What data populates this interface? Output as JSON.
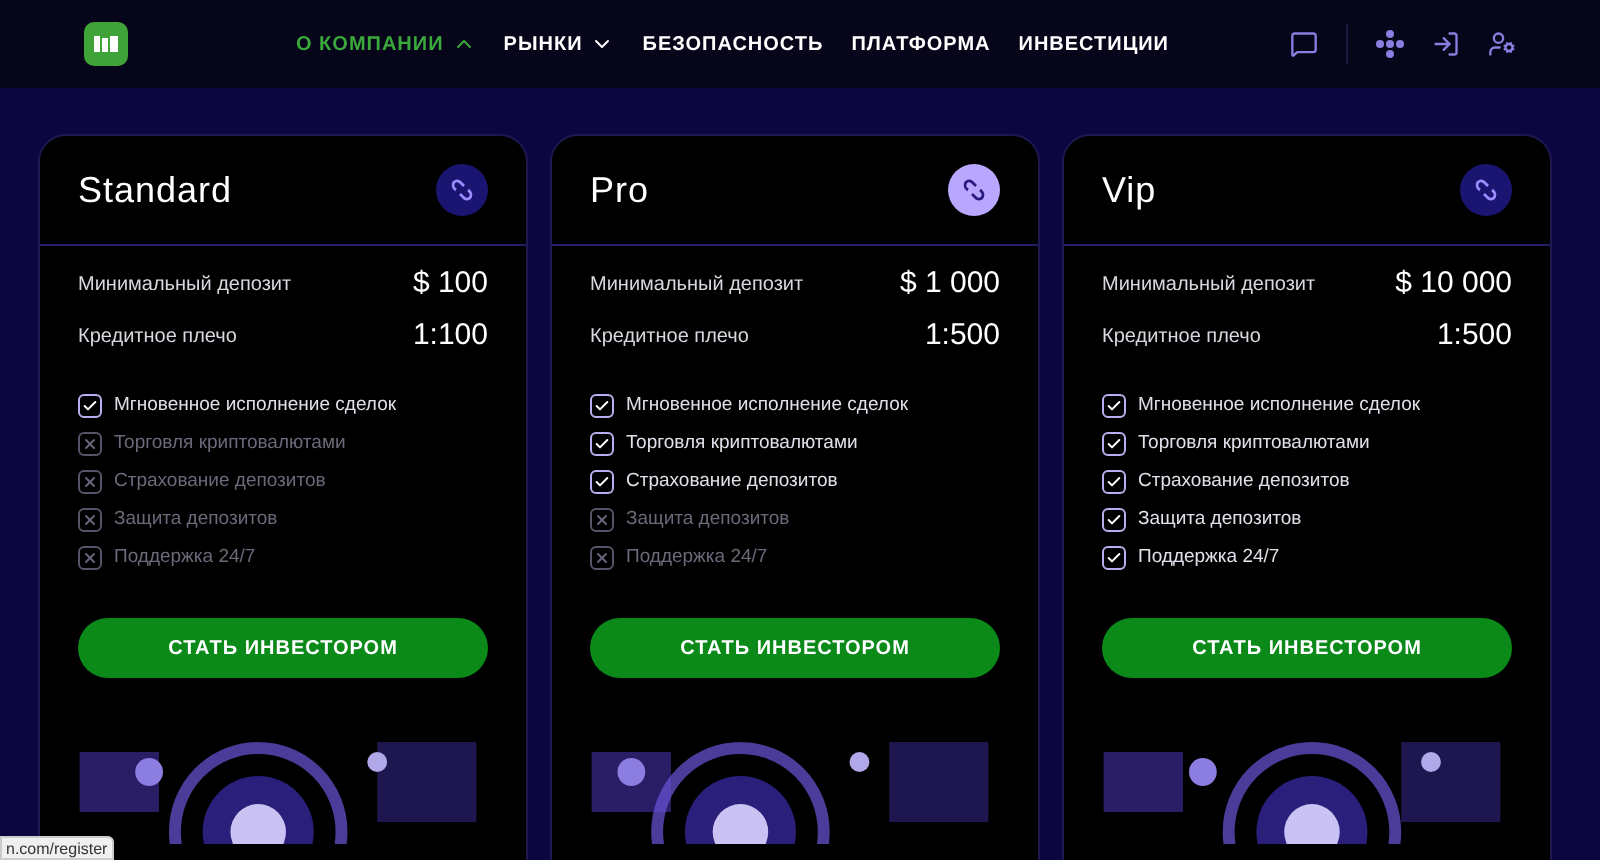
{
  "nav": {
    "items": [
      {
        "label": "О КОМПАНИИ",
        "selected": true,
        "dropdown": true
      },
      {
        "label": "РЫНКИ",
        "selected": false,
        "dropdown": true
      },
      {
        "label": "БЕЗОПАСНОСТЬ",
        "selected": false,
        "dropdown": false
      },
      {
        "label": "ПЛАТФОРМА",
        "selected": false,
        "dropdown": false
      },
      {
        "label": "ИНВЕСТИЦИИ",
        "selected": false,
        "dropdown": false
      }
    ]
  },
  "plans": [
    {
      "name": "Standard",
      "highlighted": false,
      "rows": [
        {
          "label": "Минимальный депозит",
          "value": "$ 100"
        },
        {
          "label": "Кредитное плечо",
          "value": "1:100"
        }
      ],
      "features": [
        {
          "label": "Мгновенное исполнение сделок",
          "checked": true
        },
        {
          "label": "Торговля криптовалютами",
          "checked": false
        },
        {
          "label": "Страхование депозитов",
          "checked": false
        },
        {
          "label": "Защита депозитов",
          "checked": false
        },
        {
          "label": "Поддержка 24/7",
          "checked": false
        }
      ],
      "button": "СТАТЬ ИНВЕСТОРОМ"
    },
    {
      "name": "Pro",
      "highlighted": true,
      "rows": [
        {
          "label": "Минимальный депозит",
          "value": "$ 1 000"
        },
        {
          "label": "Кредитное плечо",
          "value": "1:500"
        }
      ],
      "features": [
        {
          "label": "Мгновенное исполнение сделок",
          "checked": true
        },
        {
          "label": "Торговля криптовалютами",
          "checked": true
        },
        {
          "label": "Страхование депозитов",
          "checked": true
        },
        {
          "label": "Защита депозитов",
          "checked": false
        },
        {
          "label": "Поддержка 24/7",
          "checked": false
        }
      ],
      "button": "СТАТЬ ИНВЕСТОРОМ"
    },
    {
      "name": "Vip",
      "highlighted": false,
      "rows": [
        {
          "label": "Минимальный депозит",
          "value": "$ 10 000"
        },
        {
          "label": "Кредитное плечо",
          "value": "1:500"
        }
      ],
      "features": [
        {
          "label": "Мгновенное исполнение сделок",
          "checked": true
        },
        {
          "label": "Торговля криптовалютами",
          "checked": true
        },
        {
          "label": "Страхование депозитов",
          "checked": true
        },
        {
          "label": "Защита депозитов",
          "checked": true
        },
        {
          "label": "Поддержка 24/7",
          "checked": true
        }
      ],
      "button": "СТАТЬ ИНВЕСТОРОМ"
    }
  ],
  "status_bar": {
    "url": "n.com/register"
  }
}
